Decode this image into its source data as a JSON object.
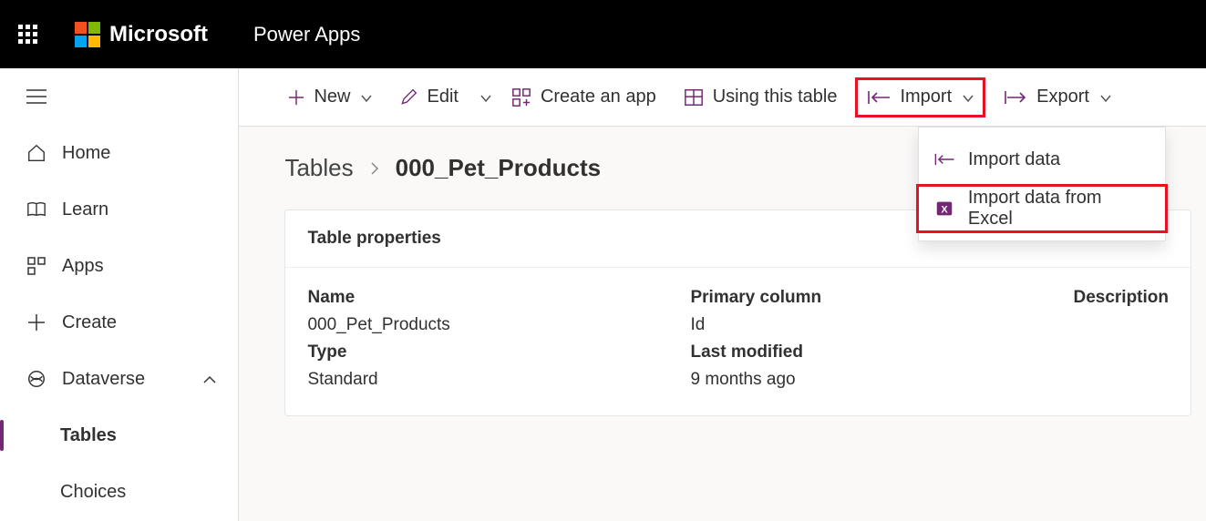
{
  "header": {
    "brand": "Microsoft",
    "app": "Power Apps"
  },
  "sidebar": {
    "home": "Home",
    "learn": "Learn",
    "apps": "Apps",
    "create": "Create",
    "dataverse": "Dataverse",
    "tables": "Tables",
    "choices": "Choices"
  },
  "toolbar": {
    "new": "New",
    "edit": "Edit",
    "create_app": "Create an app",
    "using_table": "Using this table",
    "import": "Import",
    "export": "Export"
  },
  "breadcrumb": {
    "parent": "Tables",
    "current": "000_Pet_Products"
  },
  "card": {
    "title": "Table properties",
    "labels": {
      "name": "Name",
      "primary": "Primary column",
      "description": "Description",
      "type": "Type",
      "modified": "Last modified"
    },
    "values": {
      "name": "000_Pet_Products",
      "primary": "Id",
      "description": "",
      "type": "Standard",
      "modified": "9 months ago"
    }
  },
  "menu": {
    "import_data": "Import data",
    "import_excel": "Import data from Excel"
  }
}
